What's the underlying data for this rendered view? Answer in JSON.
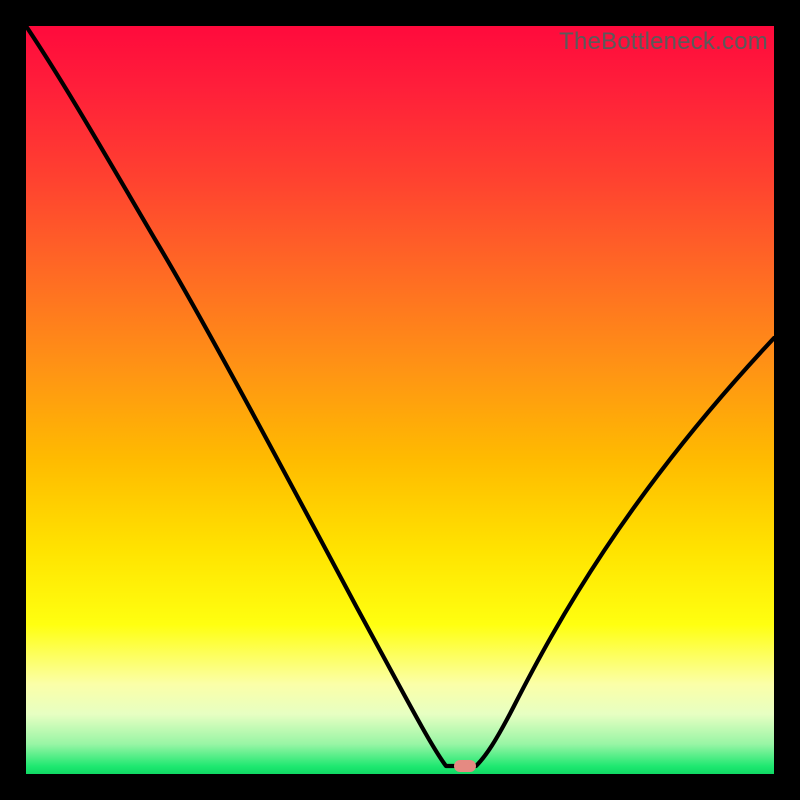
{
  "watermark": "TheBottleneck.com",
  "chart_data": {
    "type": "line",
    "title": "",
    "xlabel": "",
    "ylabel": "",
    "xlim": [
      0,
      100
    ],
    "ylim": [
      0,
      100
    ],
    "grid": false,
    "legend": false,
    "series": [
      {
        "name": "bottleneck-curve",
        "x": [
          0,
          12,
          24,
          36,
          48,
          52,
          56,
          60,
          64,
          72,
          84,
          100
        ],
        "values": [
          100,
          82,
          63,
          42,
          20,
          10,
          2,
          0,
          2,
          12,
          30,
          58
        ]
      }
    ],
    "annotations": [
      {
        "name": "minimum-marker",
        "x": 60,
        "y": 0
      }
    ]
  },
  "colors": {
    "curve": "#000000",
    "marker": "#e58a82",
    "background_top": "#ff0a3c",
    "background_bottom": "#10d864"
  }
}
